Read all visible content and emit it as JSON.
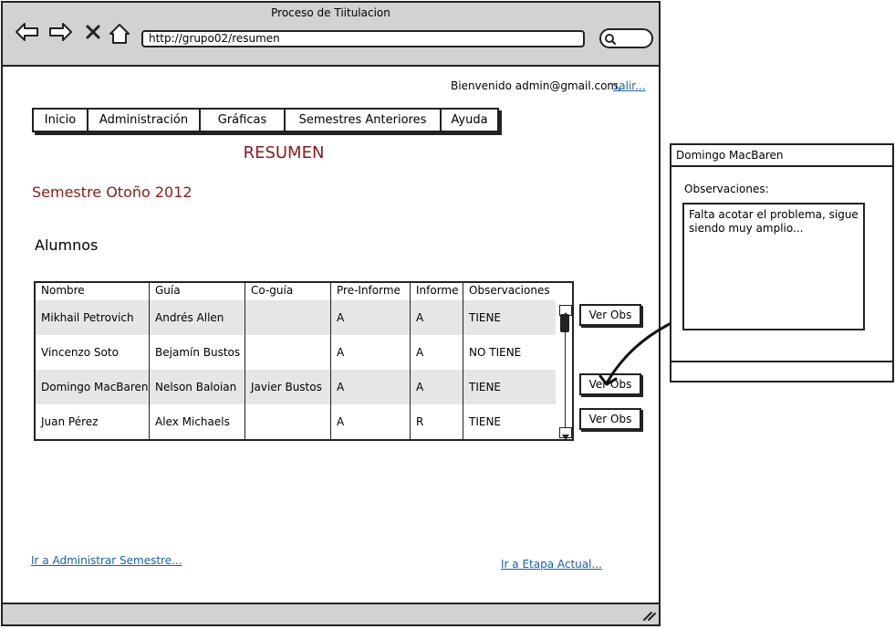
{
  "window": {
    "title": "Proceso de Tiitulacion"
  },
  "toolbar": {
    "url": "http://grupo02/resumen"
  },
  "header": {
    "welcome": "Bienvenido admin@gmail.com,",
    "logout": "salir..."
  },
  "menu": [
    "Inicio",
    "Administración",
    "Gráficas",
    "Semestres Anteriores",
    "Ayuda"
  ],
  "page": {
    "title": "RESUMEN",
    "semester": "Semestre Otoño 2012",
    "students_heading": "Alumnos"
  },
  "table": {
    "columns": [
      "Nombre",
      "Guía",
      "Co-guía",
      "Pre-Informe",
      "Informe",
      "Observaciones"
    ],
    "rows": [
      [
        "Mikhail Petrovich",
        "Andrés Allen",
        "",
        "A",
        "A",
        "TIENE"
      ],
      [
        "Vincenzo Soto",
        "Bejamín Bustos",
        "",
        "A",
        "A",
        "NO TIENE"
      ],
      [
        "Domingo MacBaren",
        "Nelson Baloian",
        "Javier Bustos",
        "A",
        "A",
        "TIENE"
      ],
      [
        "Juan Pérez",
        "Alex Michaels",
        "",
        "A",
        "R",
        "TIENE"
      ]
    ]
  },
  "buttons": {
    "view_obs": "Ver Obs"
  },
  "footer": {
    "admin_link": "Ir a Administrar Semestre...",
    "stage_link": "Ir a Etapa Actual..."
  },
  "panel": {
    "title": "Domingo MacBaren",
    "label": "Observaciones:",
    "text": "Falta acotar el problema, sigue siendo muy amplio..."
  },
  "colors": {
    "accent_red": "#8b1a1a",
    "link_blue": "#1a5fb4",
    "chrome_gray": "#d2d2d2"
  }
}
